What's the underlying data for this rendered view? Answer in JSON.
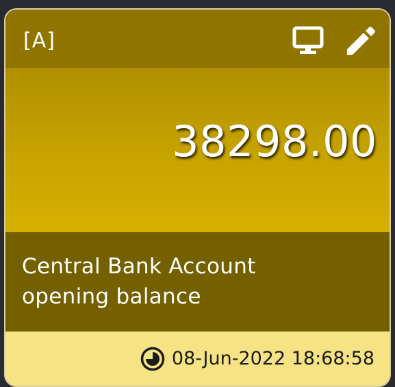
{
  "card": {
    "tag": "[A]",
    "amount": "38298.00",
    "description_line1": "Central Bank Account",
    "description_line2": "opening balance",
    "timestamp": "08-Jun-2022 18:68:58"
  },
  "icons": {
    "display": "monitor-icon",
    "edit": "pencil-icon",
    "time": "clock-icon"
  },
  "colors": {
    "header": "#8f7500",
    "value_area": "#c8a400",
    "description_area": "#756000",
    "footer": "#f6e385"
  }
}
